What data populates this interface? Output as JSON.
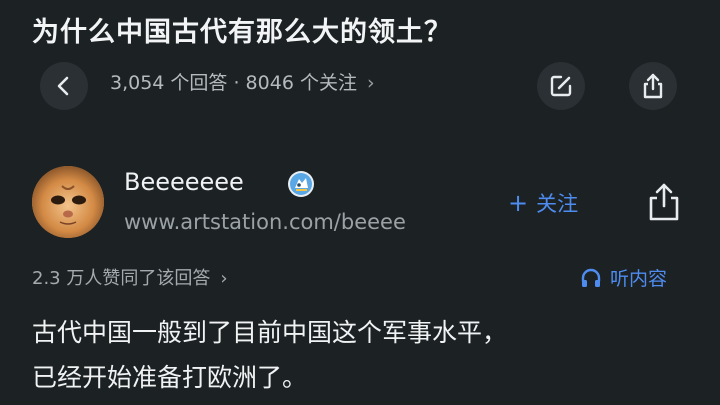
{
  "question": {
    "title": "为什么中国古代有那么大的领土？"
  },
  "stats": {
    "text": "3,054 个回答 · 8046 个关注",
    "chevron": "›"
  },
  "author": {
    "name": "Beeeeeee",
    "link": "www.artstation.com/beeee",
    "follow_label": "关注",
    "follow_icon": "+"
  },
  "agree": {
    "text": "2.3 万人赞同了该回答",
    "chevron": "›"
  },
  "listen": {
    "label": "听内容"
  },
  "answer": {
    "line1": "古代中国一般到了目前中国这个军事水平，",
    "line2": "已经开始准备打欧洲了。"
  },
  "icons": {
    "back": "chevron-left-icon",
    "edit": "edit-icon",
    "share": "share-icon",
    "verify": "verified-badge-icon",
    "headphones": "headphones-icon"
  },
  "colors": {
    "accent": "#4e8cf0",
    "background": "#1c2123"
  }
}
